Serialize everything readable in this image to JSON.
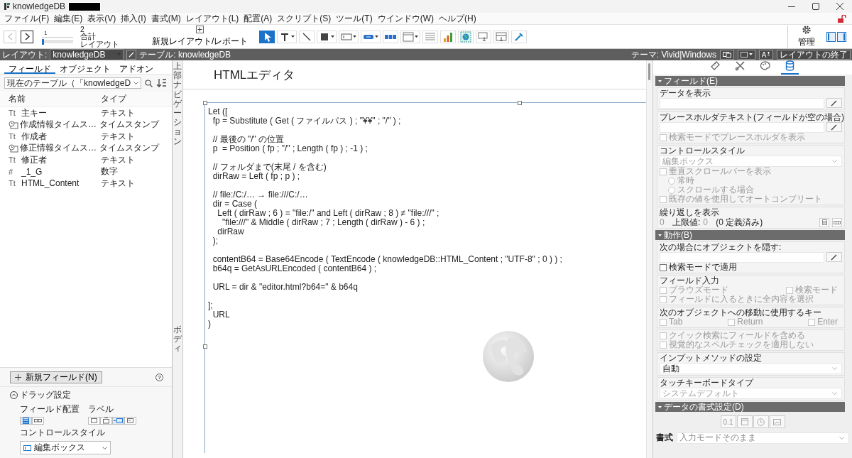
{
  "window": {
    "title": "knowledgeDB"
  },
  "menu": [
    "ファイル(F)",
    "編集(E)",
    "表示(V)",
    "挿入(I)",
    "書式(M)",
    "レイアウト(L)",
    "配置(A)",
    "スクリプト(S)",
    "ツール(T)",
    "ウインドウ(W)",
    "ヘルプ(H)"
  ],
  "toolbar": {
    "record": "1",
    "slider": {
      "level": 0
    },
    "count": "2",
    "count_label": "合計",
    "mode_label": "レイアウト",
    "new_layout": "新規レイアウト/レポート",
    "manage": "管理",
    "tools": [
      {
        "kind": "pointer",
        "selected": true
      },
      {
        "kind": "text",
        "selected": false
      },
      {
        "kind": "line",
        "selected": false
      },
      {
        "kind": "shape",
        "selected": false
      },
      {
        "kind": "field",
        "selected": false
      },
      {
        "kind": "button",
        "selected": false
      },
      {
        "kind": "button-bar",
        "selected": false
      },
      {
        "kind": "popover",
        "selected": false
      },
      {
        "kind": "portal",
        "selected": false
      },
      {
        "kind": "chart",
        "selected": false
      },
      {
        "kind": "web-viewer",
        "selected": false
      },
      {
        "kind": "field-picker",
        "selected": false
      },
      {
        "kind": "part",
        "selected": false
      },
      {
        "kind": "eyedropper",
        "selected": false
      }
    ]
  },
  "layout_bar": {
    "layout_label": "レイアウト:",
    "layout": "knowledgeDB",
    "table": "テーブル: knowledgeDB",
    "theme": "テーマ: Vivid|Windows",
    "exit": "レイアウトの終了"
  },
  "left_panel": {
    "tabs": [
      {
        "label": "フィールド",
        "selected": true
      },
      {
        "label": "オブジェクト",
        "selected": false
      },
      {
        "label": "アドオン",
        "selected": false
      }
    ],
    "table_select": "現在のテーブル（「knowledgeD",
    "columns": [
      "名前",
      "タイプ"
    ],
    "fields": [
      {
        "kind": "text",
        "icon": "Tt",
        "name": "主キー",
        "type": "テキスト"
      },
      {
        "kind": "timestamp",
        "name": "作成情報タイムス…",
        "type": "タイムスタンプ"
      },
      {
        "kind": "text",
        "icon": "Tt",
        "name": "作成者",
        "type": "テキスト"
      },
      {
        "kind": "timestamp",
        "name": "修正情報タイムス…",
        "type": "タイムスタンプ"
      },
      {
        "kind": "text",
        "icon": "Tt",
        "name": "修正者",
        "type": "テキスト"
      },
      {
        "kind": "number",
        "icon": "#",
        "name": "_1_G",
        "type": "数字"
      },
      {
        "kind": "text",
        "icon": "Tt",
        "name": "HTML_Content",
        "type": "テキスト"
      }
    ],
    "new_field": "新規フィールド(N)",
    "help": "?",
    "drag_settings": {
      "title": "ドラッグ設定",
      "expanded": true,
      "placement_label": "フィールド配置",
      "placements": [
        {
          "kind": "vertical",
          "selected": true
        },
        {
          "kind": "horizontal",
          "selected": false
        }
      ],
      "label_label": "ラベル",
      "labels": [
        {
          "kind": "none",
          "selected": false
        },
        {
          "kind": "top",
          "selected": false
        },
        {
          "kind": "left",
          "selected": true
        },
        {
          "kind": "inside",
          "selected": false
        }
      ],
      "style_label": "コントロールスタイル",
      "style": "編集ボックス"
    }
  },
  "part_labels": [
    "上部ナビゲーション",
    "ボディ"
  ],
  "canvas": {
    "header": "HTMLエディタ",
    "web_viewer": {
      "code": [
        [
          "Let ([",
          "  fp = Substitute ( Get ( ファイルパス ) ; \"¥¥\" ; \"/\" ) ;"
        ],
        [
          "  // 最後の \"/\" の位置",
          "  p  = Position ( fp ; \"/\" ; Length ( fp ) ; -1 ) ;"
        ],
        [
          "  // フォルダまで(末尾 / を含む)",
          "  dirRaw = Left ( fp ; p ) ;"
        ],
        [
          "  // file:/C:/… → file:///C:/…",
          "  dir = Case (",
          "    Left ( dirRaw ; 6 ) = \"file:/\" and Left ( dirRaw ; 8 ) ≠ \"file:///\" ;",
          "      \"file:///\" & Middle ( dirRaw ; 7 ; Length ( dirRaw ) - 6 ) ;",
          "    dirRaw",
          "  );"
        ],
        [
          "  contentB64 = Base64Encode ( TextEncode ( knowledgeDB::HTML_Content ; \"UTF-8\" ; 0 ) ) ;",
          "  b64q = GetAsURLEncoded ( contentB64 ) ;"
        ],
        [
          "  URL = dir & \"editor.html?b64=\" & b64q"
        ],
        [
          "];",
          "  URL",
          ")"
        ]
      ]
    }
  },
  "inspector": {
    "tabs": [
      {
        "kind": "ruler",
        "selected": false
      },
      {
        "kind": "tools",
        "selected": false
      },
      {
        "kind": "palette",
        "selected": false
      },
      {
        "kind": "data",
        "selected": true
      }
    ],
    "sections": [
      {
        "title": "フィールド(E)",
        "expanded": true,
        "groups": [
          [
            {
              "kind": "label",
              "text": "データを表示"
            },
            {
              "kind": "formula"
            }
          ],
          [
            {
              "kind": "label",
              "text": "プレースホルダテキスト(フィールドが空の場合)"
            },
            {
              "kind": "formula"
            },
            {
              "kind": "checkbox",
              "label": "検索モードでプレースホルダを表示",
              "checked": false,
              "disabled": true
            }
          ],
          [
            {
              "kind": "label",
              "text": "コントロールスタイル"
            },
            {
              "kind": "dropdown",
              "value": "編集ボックス",
              "disabled": true
            },
            {
              "kind": "checkbox",
              "label": "垂直スクロールバーを表示",
              "checked": false,
              "disabled": true
            },
            {
              "kind": "radio",
              "label": "常時",
              "selected": false,
              "disabled": true
            },
            {
              "kind": "radio",
              "label": "スクロールする場合",
              "selected": false,
              "disabled": true
            },
            {
              "kind": "checkbox",
              "label": "既存の値を使用してオートコンプリート",
              "checked": false,
              "disabled": true
            }
          ],
          [
            {
              "kind": "label",
              "text": "繰り返しを表示"
            },
            {
              "kind": "repeat",
              "from": "0",
              "limit_label": "上限値:",
              "to": "0",
              "note": "(0 定義済み)"
            }
          ]
        ]
      },
      {
        "title": "動作(B)",
        "expanded": true,
        "groups": [
          [
            {
              "kind": "label",
              "text": "次の場合にオブジェクトを隠す:"
            },
            {
              "kind": "formula"
            },
            {
              "kind": "checkbox",
              "label": "検索モードで適用",
              "checked": false,
              "disabled": false
            }
          ],
          [
            {
              "kind": "label",
              "text": "フィールド入力"
            },
            {
              "kind": "checkbox-row",
              "items": [
                {
                  "label": "ブラウズモード",
                  "checked": false,
                  "disabled": true
                },
                {
                  "label": "検索モード",
                  "checked": false,
                  "disabled": true
                }
              ]
            },
            {
              "kind": "checkbox",
              "label": "フィールドに入るときに全内容を選択",
              "checked": false,
              "disabled": true
            }
          ],
          [
            {
              "kind": "label",
              "text": "次のオブジェクトへの移動に使用するキー"
            },
            {
              "kind": "checkbox-row",
              "items": [
                {
                  "label": "Tab",
                  "checked": false,
                  "disabled": true
                },
                {
                  "label": "Return",
                  "checked": false,
                  "disabled": true
                },
                {
                  "label": "Enter",
                  "checked": false,
                  "disabled": true
                }
              ]
            }
          ],
          [
            {
              "kind": "checkbox",
              "label": "クイック検索にフィールドを含める",
              "checked": false,
              "disabled": true
            },
            {
              "kind": "checkbox",
              "label": "視覚的なスペルチェックを適用しない",
              "checked": false,
              "disabled": true
            }
          ],
          [
            {
              "kind": "label",
              "text": "インプットメソッドの設定"
            },
            {
              "kind": "dropdown",
              "value": "自動",
              "disabled": false
            }
          ],
          [
            {
              "kind": "label",
              "text": "タッチキーボードタイプ"
            },
            {
              "kind": "dropdown",
              "value": "システムデフォルト",
              "disabled": true
            }
          ]
        ]
      },
      {
        "title": "データの書式設定(D)",
        "expanded": true,
        "groups": [
          [
            {
              "kind": "format-icons",
              "items": [
                {
                  "kind": "number",
                  "text": "0.1"
                },
                {
                  "kind": "date"
                },
                {
                  "kind": "time"
                },
                {
                  "kind": "graphic"
                }
              ]
            }
          ],
          [
            {
              "kind": "format-row",
              "label": "書式",
              "value": "入力モードそのまま"
            }
          ]
        ]
      }
    ]
  }
}
